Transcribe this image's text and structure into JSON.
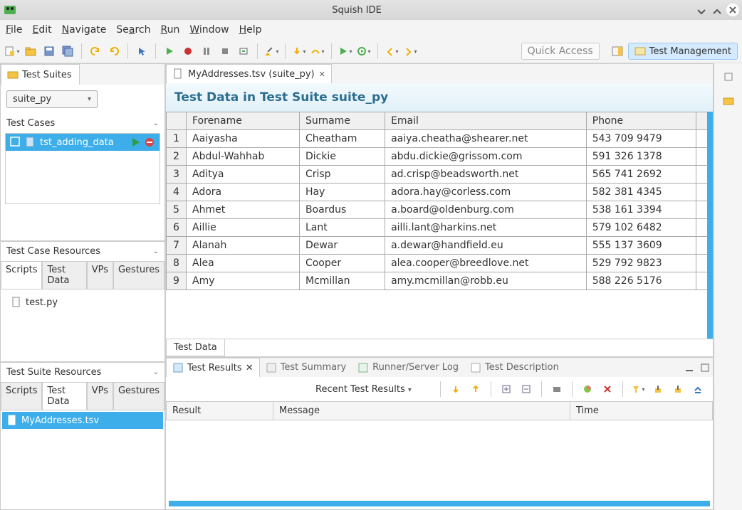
{
  "titlebar": {
    "title": "Squish IDE"
  },
  "menubar": [
    "File",
    "Edit",
    "Navigate",
    "Search",
    "Run",
    "Window",
    "Help"
  ],
  "quick_access": "Quick Access",
  "perspective": {
    "label": "Test Management"
  },
  "left": {
    "test_suites_tab": "Test Suites",
    "suite_dropdown": "suite_py",
    "test_cases_header": "Test Cases",
    "test_cases": [
      {
        "name": "tst_adding_data",
        "selected": true
      }
    ],
    "case_resources_header": "Test Case Resources",
    "case_resource_tabs": [
      "Scripts",
      "Test Data",
      "VPs",
      "Gestures"
    ],
    "case_resource_files": [
      "test.py"
    ],
    "suite_resources_header": "Test Suite Resources",
    "suite_resource_tabs": [
      "Scripts",
      "Test Data",
      "VPs",
      "Gestures"
    ],
    "suite_resource_files": [
      "MyAddresses.tsv"
    ]
  },
  "editor": {
    "tab_label": "MyAddresses.tsv (suite_py)",
    "heading": "Test Data in Test Suite suite_py",
    "columns": [
      "Forename",
      "Surname",
      "Email",
      "Phone"
    ],
    "rows": [
      [
        "Aaiyasha",
        "Cheatham",
        "aaiya.cheatha@shearer.net",
        "543 709 9479"
      ],
      [
        "Abdul-Wahhab",
        "Dickie",
        "abdu.dickie@grissom.com",
        "591 326 1378"
      ],
      [
        "Aditya",
        "Crisp",
        "ad.crisp@beadsworth.net",
        "565 741 2692"
      ],
      [
        "Adora",
        "Hay",
        "adora.hay@corless.com",
        "582 381 4345"
      ],
      [
        "Ahmet",
        "Boardus",
        "a.board@oldenburg.com",
        "538 161 3394"
      ],
      [
        "Aillie",
        "Lant",
        "ailli.lant@harkins.net",
        "579 102 6482"
      ],
      [
        "Alanah",
        "Dewar",
        "a.dewar@handfield.eu",
        "555 137 3609"
      ],
      [
        "Alea",
        "Cooper",
        "alea.cooper@breedlove.net",
        "529 792 9823"
      ],
      [
        "Amy",
        "Mcmillan",
        "amy.mcmillan@robb.eu",
        "588 226 5176"
      ]
    ],
    "bottom_tab": "Test Data"
  },
  "results": {
    "tabs": [
      "Test Results",
      "Test Summary",
      "Runner/Server Log",
      "Test Description"
    ],
    "recent_label": "Recent Test Results",
    "columns": [
      "Result",
      "Message",
      "Time"
    ]
  }
}
